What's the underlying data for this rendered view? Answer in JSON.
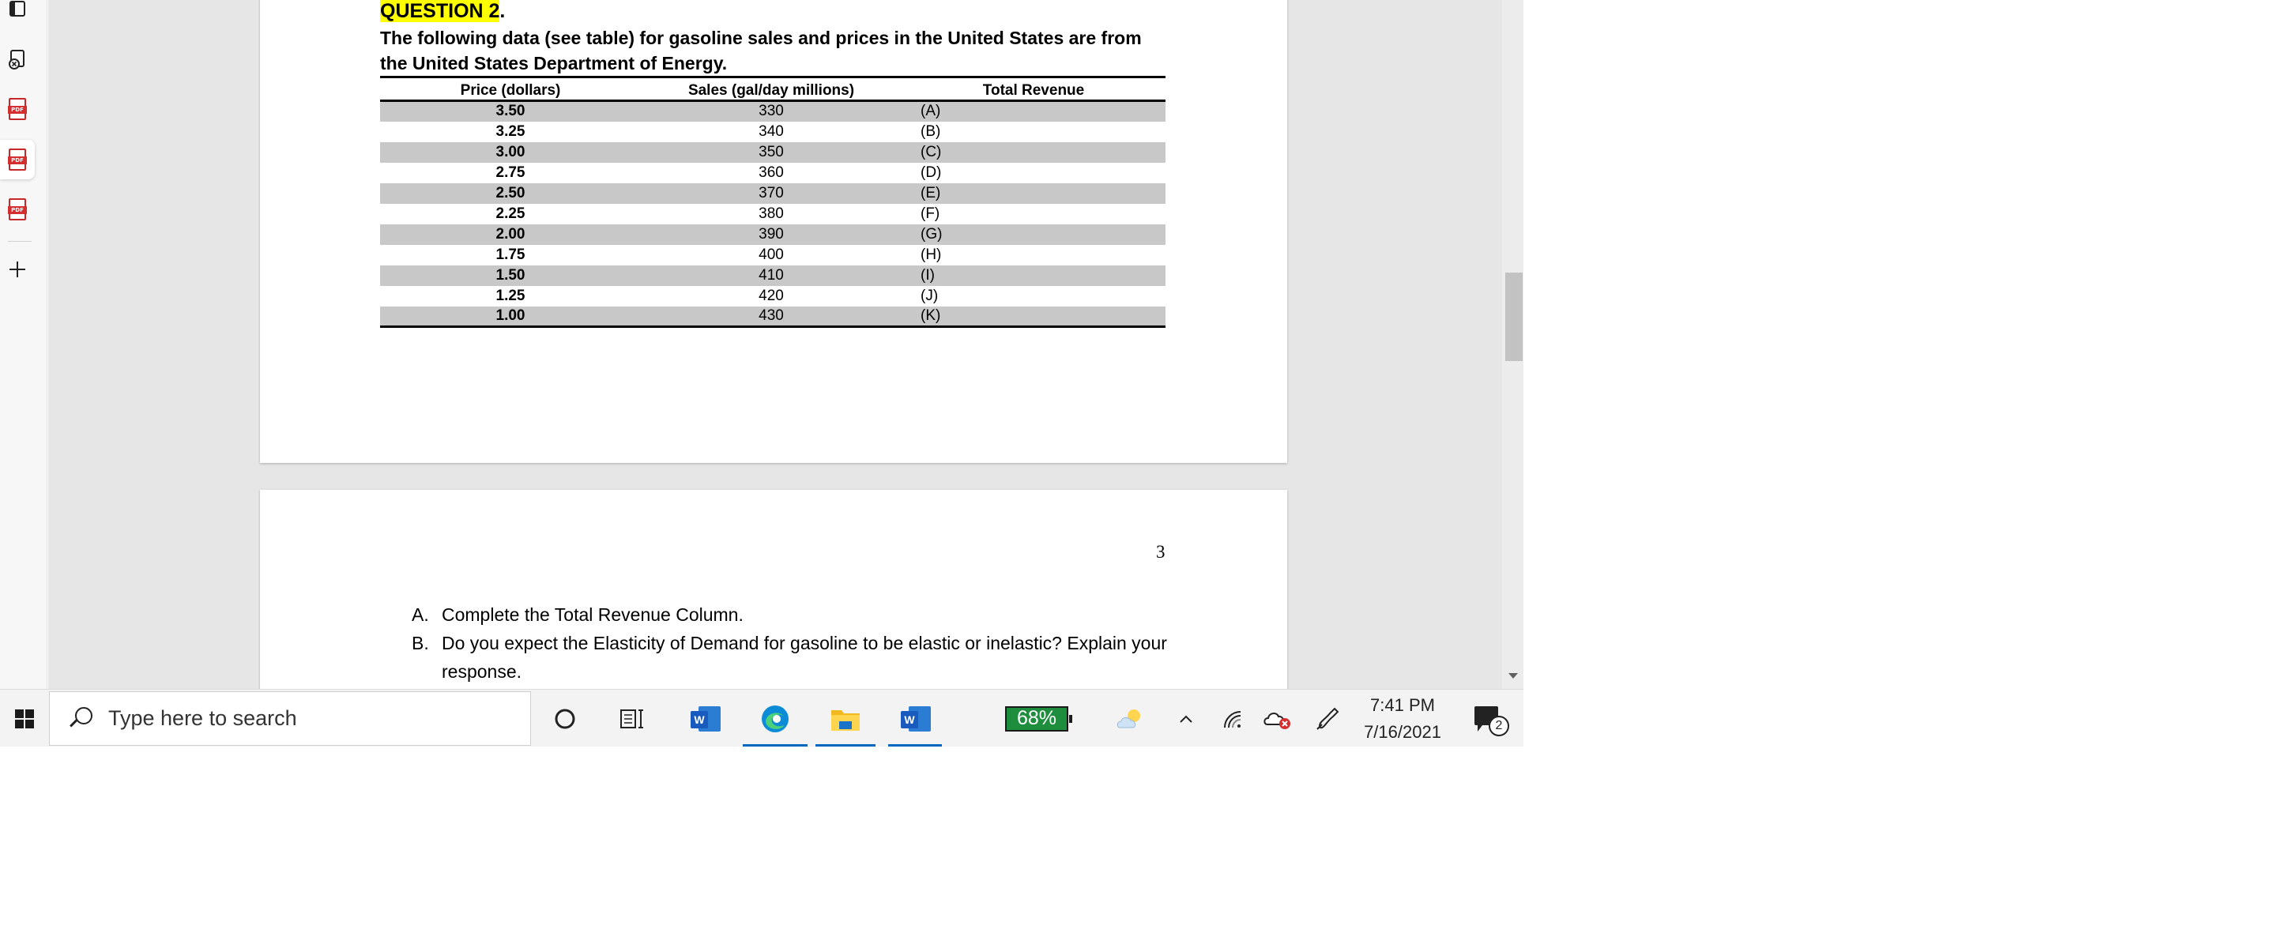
{
  "colors": {
    "highlight": "#ffff00",
    "row_shade": "#c8c8c8",
    "battery": "#1e8e3e",
    "taskbar_accent": "#0067c0",
    "pdf_red": "#d32f2f"
  },
  "rail": {
    "icons": [
      "sidebar-panel-icon",
      "profile-icon",
      "pdf-tab-icon",
      "pdf-tab-icon",
      "pdf-tab-icon",
      "new-tab-icon"
    ]
  },
  "document": {
    "question_title": "QUESTION 2",
    "question_title_suffix": ".",
    "intro": "The following data (see table) for gasoline sales and prices in the United States are from the United States Department of Energy.",
    "table": {
      "headers": [
        "Price (dollars)",
        "Sales (gal/day millions)",
        "Total Revenue"
      ],
      "rows": [
        [
          "3.50",
          "330",
          "(A)"
        ],
        [
          "3.25",
          "340",
          "(B)"
        ],
        [
          "3.00",
          "350",
          "(C)"
        ],
        [
          "2.75",
          "360",
          "(D)"
        ],
        [
          "2.50",
          "370",
          "(E)"
        ],
        [
          "2.25",
          "380",
          "(F)"
        ],
        [
          "2.00",
          "390",
          "(G)"
        ],
        [
          "1.75",
          "400",
          "(H)"
        ],
        [
          "1.50",
          "410",
          "(I)"
        ],
        [
          "1.25",
          "420",
          "(J)"
        ],
        [
          "1.00",
          "430",
          "(K)"
        ]
      ]
    },
    "page_number": "3",
    "questions": [
      {
        "marker": "A.",
        "text": "Complete the Total Revenue Column."
      },
      {
        "marker": "B.",
        "text": "Do you expect the Elasticity of Demand for gasoline to be elastic or inelastic? Explain your response."
      }
    ]
  },
  "taskbar": {
    "search_placeholder": "Type here to search",
    "battery_percent": "68%",
    "time": "7:41 PM",
    "date": "7/16/2021",
    "notification_count": "2",
    "pinned": [
      "cortana-icon",
      "task-view-icon",
      "word-icon",
      "edge-icon",
      "file-explorer-icon",
      "word-icon"
    ]
  }
}
